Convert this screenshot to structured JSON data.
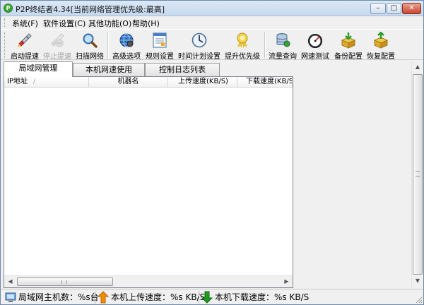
{
  "window": {
    "title": "P2P终结者4.34[当前网络管理优先级:最高]",
    "app_icon_glyph": "P",
    "controls": {
      "minimize": "–",
      "maximize": "□",
      "close": "✕"
    }
  },
  "menu": {
    "items": [
      "系统(F)",
      "软件设置(C)",
      "其他功能(O)",
      "帮助(H)"
    ]
  },
  "toolbar": {
    "buttons": [
      {
        "label": "启动提速",
        "icon": "rocket-icon",
        "enabled": true
      },
      {
        "label": "停止提速",
        "icon": "rocket-stop-icon",
        "enabled": false
      },
      {
        "label": "扫描网络",
        "icon": "magnifier-icon",
        "enabled": true
      },
      {
        "label": "高级选项",
        "icon": "globe-icon",
        "enabled": true
      },
      {
        "label": "规则设置",
        "icon": "form-icon",
        "enabled": true
      },
      {
        "label": "时间计划设置",
        "icon": "clock-icon",
        "enabled": true
      },
      {
        "label": "提升优先级",
        "icon": "award-ribbon-icon",
        "enabled": true
      },
      {
        "label": "流量查询",
        "icon": "database-icon",
        "enabled": true
      },
      {
        "label": "网速测试",
        "icon": "speedometer-icon",
        "enabled": true
      },
      {
        "label": "备份配置",
        "icon": "box-down-icon",
        "enabled": true
      },
      {
        "label": "恢复配置",
        "icon": "box-up-icon",
        "enabled": true
      }
    ]
  },
  "tabs": [
    {
      "label": "局域网管理",
      "active": true
    },
    {
      "label": "本机网速使用",
      "active": false
    },
    {
      "label": "控制日志列表",
      "active": false
    }
  ],
  "table": {
    "columns": [
      "IP地址",
      "机器名",
      "上传速度(KB/S)",
      "下载速度(KB/S)"
    ],
    "sort_indicator": "/",
    "rows": []
  },
  "statusbar": {
    "hosts": "局域网主机数：%s台",
    "upload": "本机上传速度：%s KB/S",
    "download": "本机下载速度：%s KB/S"
  },
  "colors": {
    "upload_arrow": "#f08c00",
    "download_arrow": "#1e9a1e",
    "accent": "#6f8aa8"
  }
}
